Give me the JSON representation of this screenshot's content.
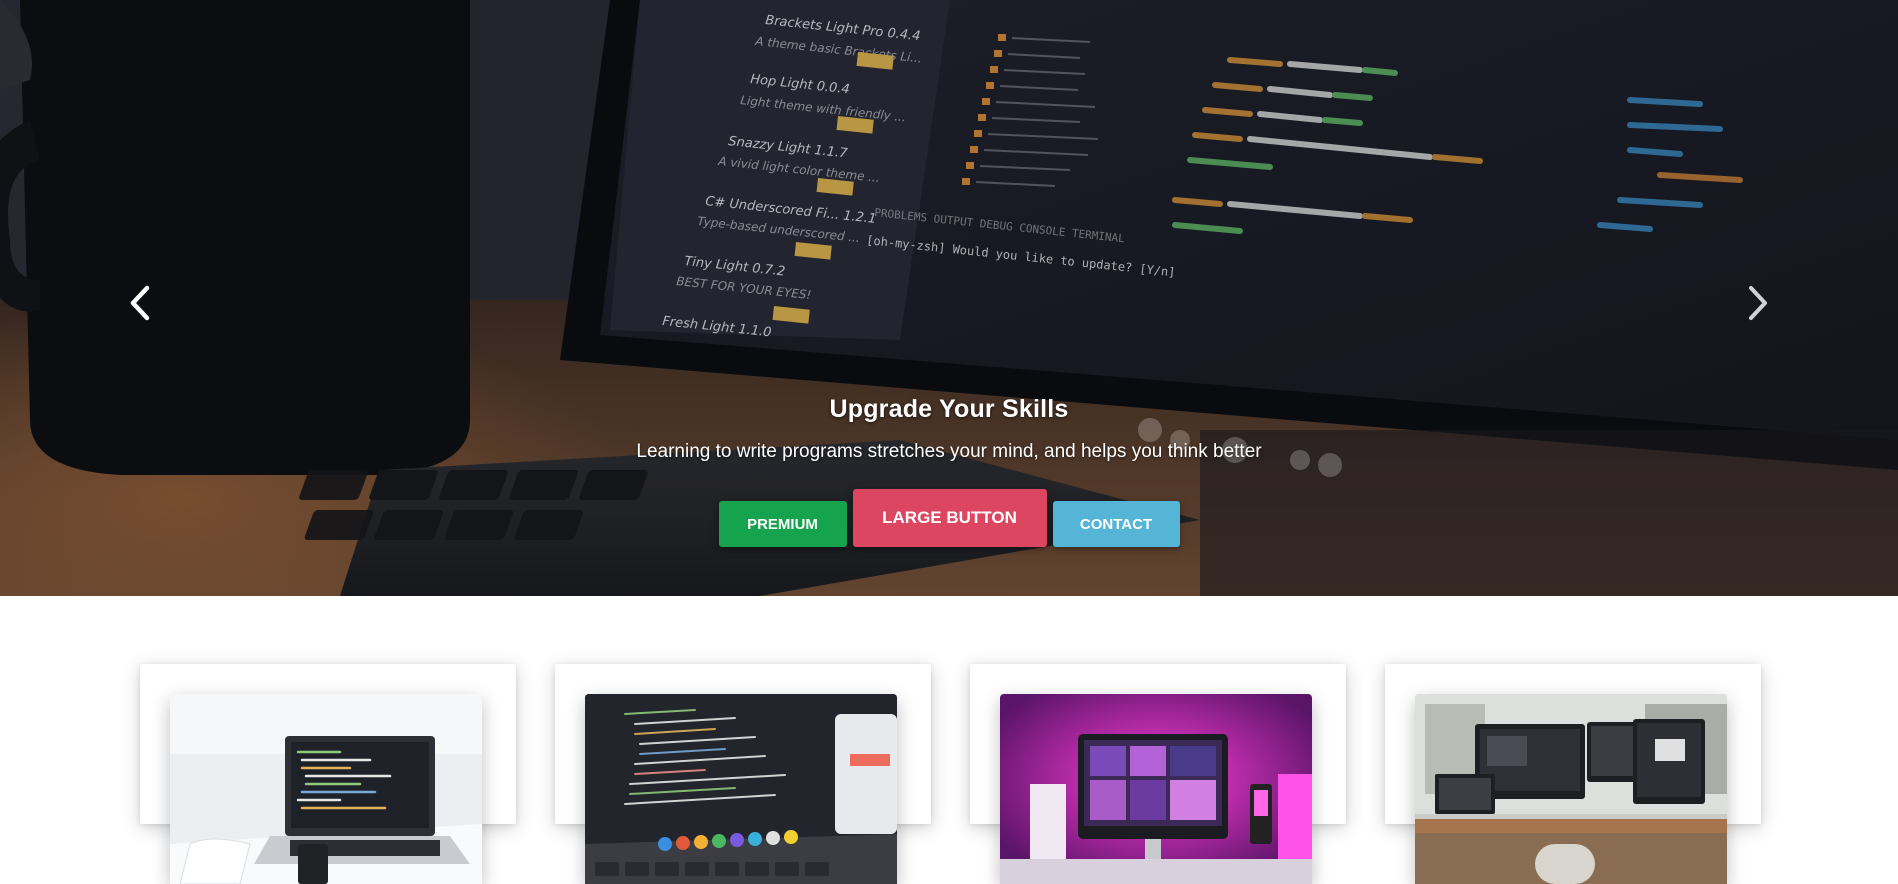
{
  "hero": {
    "title": "Upgrade Your Skills",
    "subtitle": "Learning to write programs stretches your mind, and helps you think better",
    "buttons": {
      "premium": "PREMIUM",
      "large": "LARGE BUTTON",
      "contact": "CONTACT"
    },
    "icons": {
      "prev": "chevron-left-icon",
      "next": "chevron-right-icon"
    },
    "colors": {
      "premium": "#16a34e",
      "large": "#dc4660",
      "contact": "#55b5d7"
    }
  },
  "cards": [
    {
      "image": "laptop-on-white-desk"
    },
    {
      "image": "code-on-laptop-screen"
    },
    {
      "image": "pink-lit-imac-desk"
    },
    {
      "image": "multi-monitor-workstation"
    }
  ]
}
